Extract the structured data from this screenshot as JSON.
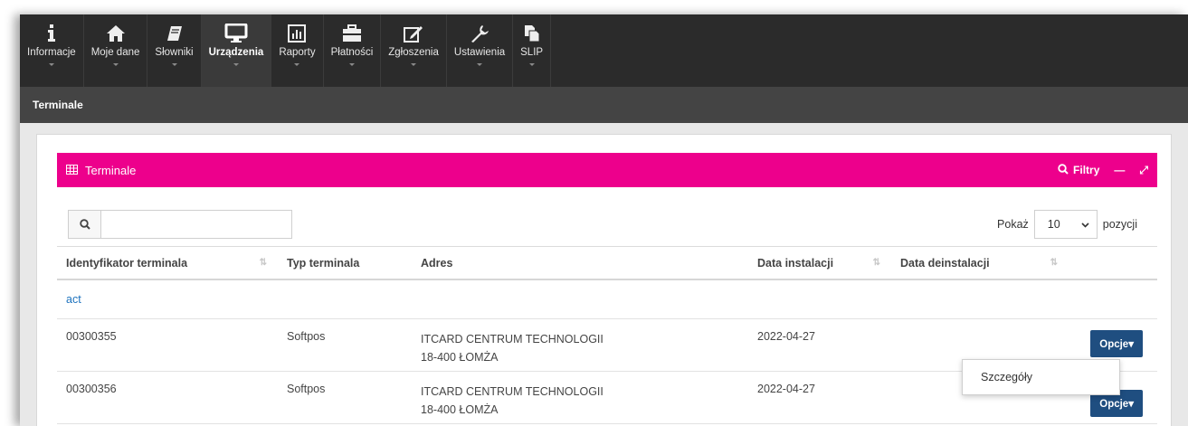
{
  "nav": {
    "items": [
      {
        "label": "Informacje",
        "icon": "info-icon"
      },
      {
        "label": "Moje dane",
        "icon": "home-icon"
      },
      {
        "label": "Słowniki",
        "icon": "book-icon"
      },
      {
        "label": "Urządzenia",
        "icon": "monitor-icon",
        "active": true
      },
      {
        "label": "Raporty",
        "icon": "bar-chart-icon"
      },
      {
        "label": "Płatności",
        "icon": "briefcase-icon"
      },
      {
        "label": "Zgłoszenia",
        "icon": "edit-icon"
      },
      {
        "label": "Ustawienia",
        "icon": "wrench-icon"
      },
      {
        "label": "SLIP",
        "icon": "copy-icon"
      }
    ]
  },
  "breadcrumb": {
    "title": "Terminale"
  },
  "panel": {
    "title": "Terminale",
    "filters_label": "Filtry",
    "minimize_symbol": "—",
    "expand_symbol": "⤢"
  },
  "toolbar": {
    "search_value": "",
    "show_label": "Pokaż",
    "page_size": "10",
    "positions_label": "pozycji"
  },
  "table": {
    "columns": [
      "Identyfikator terminala",
      "Typ terminala",
      "Adres",
      "Data instalacji",
      "Data deinstalacji"
    ],
    "group_label": "act",
    "rows": [
      {
        "id": "00300355",
        "type": "Softpos",
        "address_line1": "ITCARD CENTRUM TECHNOLOGII",
        "address_line2": "18-400 ŁOMŻA",
        "install_date": "2022-04-27",
        "uninstall_date": "",
        "options_label": "Opcje"
      },
      {
        "id": "00300356",
        "type": "Softpos",
        "address_line1": "ITCARD CENTRUM TECHNOLOGII",
        "address_line2": "18-400 ŁOMŻA",
        "install_date": "2022-04-27",
        "uninstall_date": "",
        "options_label": "Opcje"
      }
    ]
  },
  "dropdown": {
    "item_label": "Szczegóły"
  },
  "colors": {
    "accent": "#ed008c",
    "button": "#1f4e80",
    "nav_bg": "#2b2b2b",
    "subbar_bg": "#444444"
  }
}
